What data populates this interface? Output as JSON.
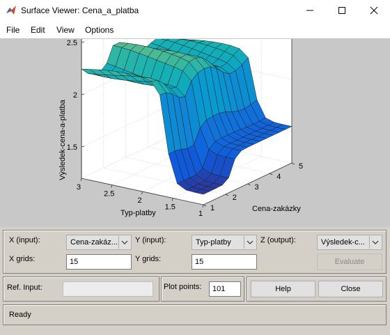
{
  "window": {
    "title": "Surface Viewer: Cena_a_platba"
  },
  "menu": [
    "File",
    "Edit",
    "View",
    "Options"
  ],
  "plot": {
    "zlabel": "Výsledek-cena-a-platba",
    "xlabel": "Cena-zakázky",
    "ylabel": "Typ-platby",
    "z_ticks": [
      "2.5",
      "2",
      "1.5"
    ],
    "x_ticks": [
      "1",
      "2",
      "3",
      "4",
      "5"
    ],
    "y_ticks": [
      "3",
      "2.5",
      "2",
      "1.5",
      "1"
    ],
    "x_range": [
      1,
      5
    ],
    "y_range": [
      1,
      3
    ],
    "z_range": [
      1.2,
      2.8
    ],
    "grid": true,
    "colormap": "parula"
  },
  "controls": {
    "x_input_label": "X (input):",
    "x_input_value": "Cena-zakáz...",
    "y_input_label": "Y (input):",
    "y_input_value": "Typ-platby",
    "z_output_label": "Z (output):",
    "z_output_value": "Výsledek-c...",
    "x_grids_label": "X grids:",
    "x_grids_value": "15",
    "y_grids_label": "Y grids:",
    "y_grids_value": "15",
    "evaluate_label": "Evaluate",
    "ref_input_label": "Ref. Input:",
    "ref_input_value": "",
    "plot_points_label": "Plot points:",
    "plot_points_value": "101",
    "help_label": "Help",
    "close_label": "Close"
  },
  "status": {
    "text": "Ready"
  }
}
